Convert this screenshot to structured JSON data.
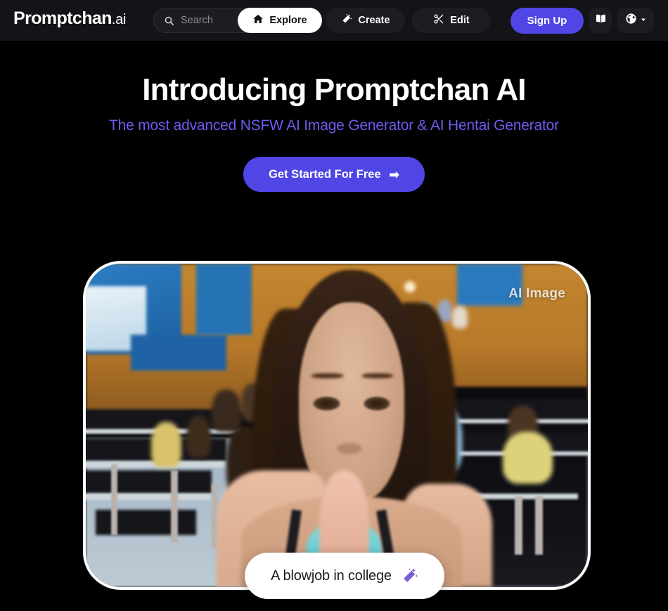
{
  "brand": {
    "name": "Promptchan",
    "suffix": ".ai"
  },
  "header": {
    "search": {
      "placeholder": "Search",
      "value": "",
      "icon": "search-icon"
    },
    "nav": [
      {
        "label": "Explore",
        "icon": "home-icon",
        "active": true
      },
      {
        "label": "Create",
        "icon": "magic-wand-icon",
        "active": false
      },
      {
        "label": "Edit",
        "icon": "scissors-icon",
        "active": false
      }
    ],
    "signup_label": "Sign Up",
    "book_icon": "book-icon",
    "language_icon": "globe-icon",
    "language_chevron": "chevron-down-icon",
    "background_color": "#131318",
    "accent_color": "#4f46e5"
  },
  "hero": {
    "title": "Introducing Promptchan AI",
    "subtitle": "The most advanced NSFW AI Image Generator & AI Hentai Generator",
    "subtitle_color": "#6d5cf0",
    "cta_label": "Get Started For Free",
    "cta_arrow": "➡",
    "cta_color": "#4f46e5"
  },
  "showcase": {
    "badge": "AI Image",
    "caption": "A blowjob in college",
    "caption_icon": "magic-wand-icon",
    "caption_icon_color": "#7c5cd6",
    "frame_border_color": "#fdfdfd"
  }
}
